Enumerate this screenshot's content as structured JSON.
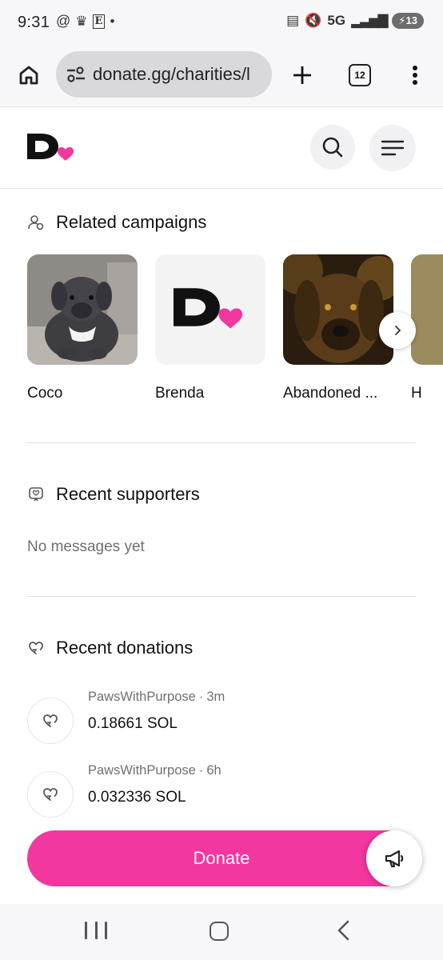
{
  "status_bar": {
    "time": "9:31",
    "network": "5G",
    "battery": "13"
  },
  "browser": {
    "url": "donate.gg/charities/l",
    "tab_count": "12"
  },
  "related": {
    "title": "Related campaigns",
    "items": [
      {
        "label": "Coco"
      },
      {
        "label": "Brenda"
      },
      {
        "label": "Abandoned ..."
      },
      {
        "label": "H"
      }
    ]
  },
  "supporters": {
    "title": "Recent supporters",
    "empty": "No messages yet"
  },
  "donations": {
    "title": "Recent donations",
    "items": [
      {
        "donor": "PawsWithPurpose",
        "time": "3m",
        "amount": "0.18661 SOL"
      },
      {
        "donor": "PawsWithPurpose",
        "time": "6h",
        "amount": "0.032336 SOL"
      }
    ]
  },
  "donate_label": "Donate",
  "colors": {
    "brand_pink": "#f2379f",
    "logo_black": "#111111"
  }
}
